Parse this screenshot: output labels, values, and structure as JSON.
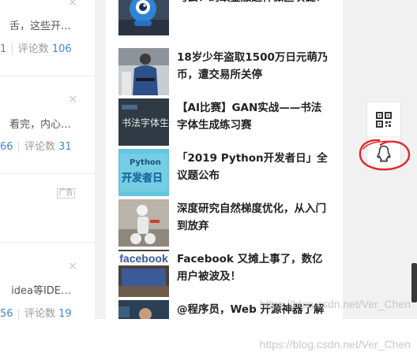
{
  "feed": {
    "cards": [
      {
        "snippet": "舌，这些开…",
        "stat_left": "1",
        "comments_label": "评论数",
        "comments": "106"
      },
      {
        "snippet": "看完，内心…",
        "stat_left": "66",
        "comments_label": "评论数",
        "comments": "31"
      },
      {
        "snippet": "idea等IDE…",
        "stat_left": "56",
        "comments_label": "评论数",
        "comments": "19"
      }
    ],
    "close_glyph": "×",
    "ad_label": "广告"
  },
  "articles": [
    {
      "title": "马云：蚂蚁金服这样做区块链！",
      "thumb_icon": "blue-mascot-icon"
    },
    {
      "title": "18岁少年盗取1500万日元萌乃币，遭交易所关停",
      "thumb_icon": "police-photo-icon"
    },
    {
      "title": "【AI比赛】GAN实战——书法字体生成练习赛",
      "thumb_icon": "calligraphy-banner-icon"
    },
    {
      "title": "「2019 Python开发者日」全议题公布",
      "thumb_icon": "python-banner-icon",
      "thumb_text": "Python",
      "thumb_text2": "开发者日"
    },
    {
      "title": "深度研究自然梯度优化，从入门到放弃",
      "thumb_icon": "robot-photo-icon"
    },
    {
      "title": "Facebook 又摊上事了，数亿用户被波及！",
      "thumb_icon": "facebook-sign-icon",
      "thumb_text": "facebook"
    },
    {
      "title": "@程序员，Web 开源神器了解",
      "thumb_icon": "person-photo-icon"
    }
  ],
  "toolbar": {
    "buttons": [
      "qrcode-icon",
      "qq-icon"
    ]
  },
  "colors": {
    "link_blue": "#3e8ad3",
    "annotation_red": "#e8242b",
    "page_bg": "#f1f1f1"
  },
  "watermark": "https://blog.csdn.net/Ver_Chen"
}
